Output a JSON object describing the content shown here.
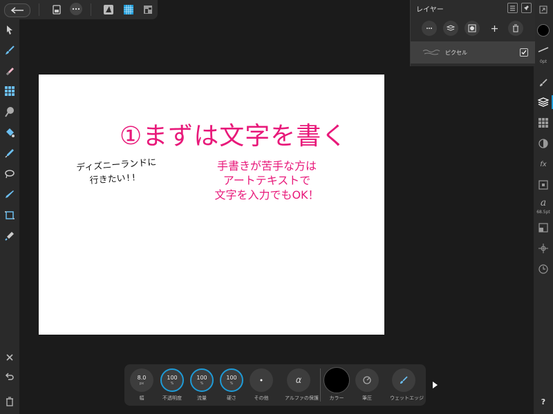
{
  "layers_panel": {
    "title": "レイヤー",
    "layer": {
      "name": "ピクセル",
      "visible": true
    }
  },
  "canvas": {
    "headline": "①まずは文字を書く",
    "subtext": [
      "手書きが苦手な方は",
      "アートテキストで",
      "文字を入力でもOK！"
    ],
    "handwriting": [
      "ディズニーランドに",
      "行きたい!!"
    ]
  },
  "right_toolbar": {
    "brush_size_label": "0pt",
    "char_size_label": "68.5pt",
    "help_label": "?"
  },
  "context_bar": {
    "width": {
      "value": "8.0",
      "unit": "px",
      "label": "幅"
    },
    "opacity": {
      "value": "100",
      "unit": "%",
      "label": "不透明度"
    },
    "flow": {
      "value": "100",
      "unit": "%",
      "label": "流量"
    },
    "hardness": {
      "value": "100",
      "unit": "%",
      "label": "硬さ"
    },
    "more": {
      "label": "その他"
    },
    "alpha": {
      "symbol": "α",
      "label": "アルファの保護"
    },
    "color": {
      "label": "カラー",
      "value": "#000000"
    },
    "pressure": {
      "label": "筆圧"
    },
    "wet_edge": {
      "label": "ウェットエッジ"
    }
  },
  "colors": {
    "accent": "#1e9bd7",
    "text_pink": "#e8197a",
    "panel_bg": "#2c2c2c",
    "app_bg": "#1b1b1b"
  }
}
